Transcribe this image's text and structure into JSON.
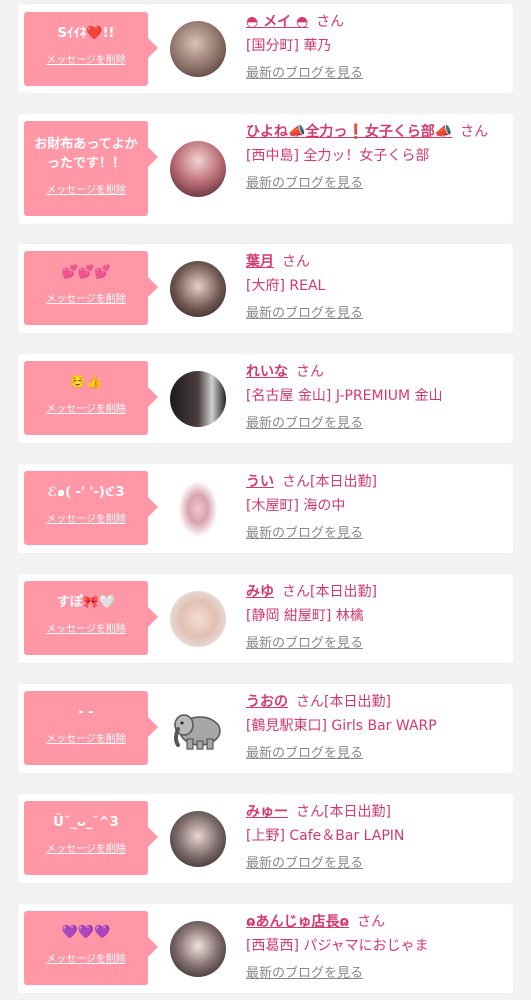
{
  "delete_label": "メッセージを削除",
  "blog_label": "最新のブログを見る",
  "san_label": "さん",
  "colors": {
    "bubble": "#ff97a6",
    "name": "#d23a6e",
    "link": "#888888",
    "background": "#f2f2f2"
  },
  "items": [
    {
      "message": "Sｲｲﾈ❤️!!",
      "name": "◓ メイ ◓",
      "status": "",
      "shop": "[国分町] 華乃"
    },
    {
      "message": "お財布あってよかったです！！",
      "name": "ひよね📣全力っ❗女子くら部📣",
      "status": "",
      "shop": "[西中島] 全力ッ！女子くら部"
    },
    {
      "message": "💕💕💕",
      "name": "葉月",
      "status": "",
      "shop": "[大府] REAL"
    },
    {
      "message": "☺️👍",
      "name": "れいな",
      "status": "",
      "shop": "[名古屋 金山] J-PREMIUM 金山"
    },
    {
      "message": "ℰ๑( -' '-)ℭ3",
      "name": "うい",
      "status": "[本日出勤]",
      "shop": "[木屋町] 海の中"
    },
    {
      "message": "すぽ🎀🤍",
      "name": "みゆ",
      "status": "[本日出勤]",
      "shop": "[静岡 紺屋町] 林檎"
    },
    {
      "message": "- -",
      "name": "うおの",
      "status": "[本日出勤]",
      "shop": "[鶴見駅東口] Girls Bar WARP"
    },
    {
      "message": "Ü˘_ᴗ_˘^3",
      "name": "みゅー",
      "status": "[本日出勤]",
      "shop": "[上野] Cafe＆Bar LAPIN"
    },
    {
      "message": "💜💜💜",
      "name": "ɷあんじゅ店長ɷ",
      "status": "",
      "shop": "[西葛西] パジャマにおじゃま"
    }
  ]
}
